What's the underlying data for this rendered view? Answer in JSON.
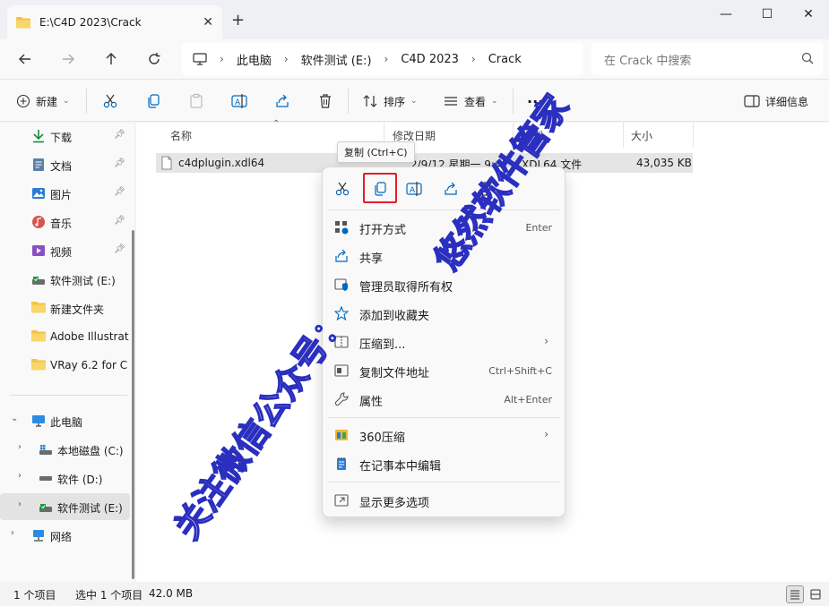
{
  "window": {
    "tab_title": "E:\\C4D 2023\\Crack",
    "new_tab": "+",
    "minimize": "—",
    "maximize": "☐",
    "close": "✕"
  },
  "address": {
    "crumbs": [
      "此电脑",
      "软件测试 (E:)",
      "C4D 2023",
      "Crack"
    ],
    "search_placeholder": "在 Crack 中搜索"
  },
  "toolbar": {
    "new_label": "新建",
    "sort_label": "排序",
    "view_label": "查看",
    "more_label": "···",
    "details_label": "详细信息"
  },
  "sidebar": {
    "quick": [
      {
        "label": "下载",
        "icon": "download-icon"
      },
      {
        "label": "文档",
        "icon": "document-icon"
      },
      {
        "label": "图片",
        "icon": "picture-icon"
      },
      {
        "label": "音乐",
        "icon": "music-icon"
      },
      {
        "label": "视频",
        "icon": "video-icon"
      },
      {
        "label": "软件测试 (E:)",
        "icon": "drive-icon"
      },
      {
        "label": "新建文件夹",
        "icon": "folder-icon"
      },
      {
        "label": "Adobe Illustrat",
        "icon": "folder-icon"
      },
      {
        "label": "VRay 6.2 for C",
        "icon": "folder-icon"
      }
    ],
    "tree": [
      {
        "label": "此电脑",
        "icon": "pc-icon"
      },
      {
        "label": "本地磁盘 (C:)",
        "icon": "windows-drive-icon"
      },
      {
        "label": "软件 (D:)",
        "icon": "drive-icon"
      },
      {
        "label": "软件测试 (E:)",
        "icon": "drive-icon"
      },
      {
        "label": "网络",
        "icon": "network-icon"
      }
    ]
  },
  "columns": {
    "name": "名称",
    "date": "修改日期",
    "type": "类型",
    "size": "大小"
  },
  "file": {
    "name": "c4dplugin.xdl64",
    "date": "2/9/12 星期一 9:41",
    "type": "XDL64 文件",
    "size": "43,035 KB"
  },
  "tooltip": "复制 (Ctrl+C)",
  "context_menu": {
    "items": [
      {
        "label": "打开方式",
        "shortcut": "Enter"
      },
      {
        "label": "共享",
        "shortcut": ""
      },
      {
        "label": "管理员取得所有权",
        "shortcut": ""
      },
      {
        "label": "添加到收藏夹",
        "shortcut": ""
      },
      {
        "label": "压缩到...",
        "shortcut": ""
      },
      {
        "label": "复制文件地址",
        "shortcut": "Ctrl+Shift+C"
      },
      {
        "label": "属性",
        "shortcut": "Alt+Enter"
      },
      {
        "label": "360压缩",
        "shortcut": ""
      },
      {
        "label": "在记事本中编辑",
        "shortcut": ""
      },
      {
        "label": "显示更多选项",
        "shortcut": ""
      }
    ]
  },
  "status": {
    "count": "1 个项目",
    "selected": "选中 1 个项目",
    "size": "42.0 MB"
  },
  "watermark": {
    "text1": "关注微信公众号：",
    "text2": "悠然软件管家"
  },
  "colors": {
    "accent": "#0067c0",
    "highlight_border": "#e0202a",
    "folder": "#f5c342",
    "watermark": "#2a2fbf"
  }
}
